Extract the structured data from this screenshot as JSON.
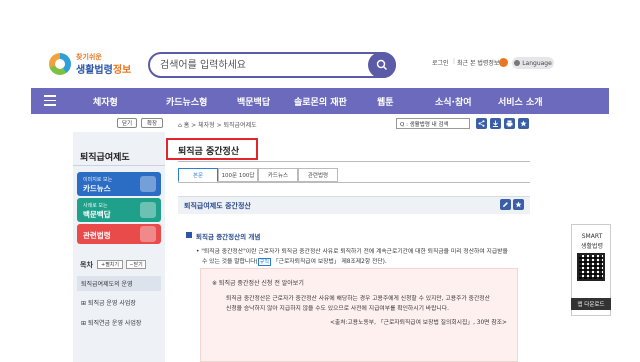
{
  "logo": {
    "small": "찾기쉬운",
    "big_blue": "생활법령",
    "big_accent": "정보"
  },
  "search": {
    "placeholder": "검색어를 입력하세요"
  },
  "util": {
    "login": "로그인",
    "recent": "최근 본 법령정보",
    "language": "Language"
  },
  "nav": {
    "items": [
      "체자형",
      "카드뉴스형",
      "백문백답",
      "솔로몬의 재판",
      "웹툰",
      "소식·참여",
      "서비스 소개"
    ]
  },
  "sidebar": {
    "top_buttons": [
      "닫기",
      "확장"
    ],
    "title": "퇴직급여제도",
    "cards": [
      {
        "sub": "이미지로 보는",
        "main": "카드뉴스",
        "color": "#2b6cc4"
      },
      {
        "sub": "사례로 보는",
        "main": "백문백답",
        "color": "#1ea08a"
      },
      {
        "sub": "",
        "main": "관련법령",
        "color": "#e94b4b"
      }
    ],
    "toc_label": "목차",
    "toc_buttons": [
      "펼치기",
      "닫기"
    ],
    "toc_items": [
      "퇴직급여제도의 운영",
      "퇴직금 운영 사업장",
      "퇴직연금 운영 사업장"
    ]
  },
  "content": {
    "breadcrumb": "홈 > 체자형 > 퇴직급여제도",
    "select": "Q : 생활법령 내 검색",
    "title": "퇴직금 중간정산",
    "tabs": [
      "본문",
      "100문 100답",
      "카드뉴스",
      "관련법령"
    ],
    "section_title": "퇴직급여제도 중간정산",
    "concept_head": "퇴직금 중간정산의 개념",
    "concept_line1": "• \"퇴직금 중간정산\"이란 근로자가 퇴직금 중간정산 사유로 퇴직하기 전에 계속근로기간에 대한 퇴직금을 미리 정산하여 지급받을",
    "concept_line2_pre": "수 있는 것을 말합니다(",
    "concept_tag": "규칙",
    "concept_line2_post": " 「근로자퇴직급여 보장법」 제8조제2항 전단).",
    "note_head": "※ 퇴직금 중간정산 신청 전 알아보기",
    "note_line1": "퇴직금 중간정산은 근로자가 중간정산 사유에 해당하는 경우 고용주에게 신청할 수 있지만, 고용주가 중간정산",
    "note_line2": "신청을 승낙하지 않아 지급하지 않을 수도 있으므로 사전에 지급여부를 확인하시기 바랍니다.",
    "note_source": "<출처:고용노동부, 「근로자퇴직급여 보장법 질의회시집」, 30면 참조>"
  },
  "qr": {
    "line1": "SMART",
    "line2": "생활법령",
    "download": "앱 다운로드"
  },
  "colors": {
    "nav": "#6c6abd",
    "accent_red": "#e3262d",
    "link_blue": "#2a7fd4"
  }
}
